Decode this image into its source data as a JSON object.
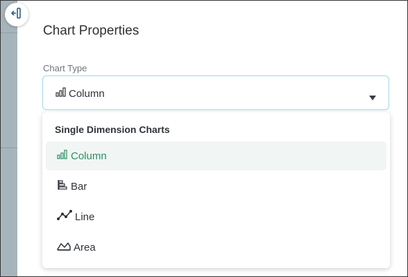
{
  "panel": {
    "title": "Chart Properties",
    "collapse_icon": "collapse-left-icon"
  },
  "chart_type": {
    "label": "Chart Type",
    "selected_value": "Column",
    "selected_icon": "column-chart-icon"
  },
  "dropdown": {
    "group_label": "Single Dimension Charts",
    "options": [
      {
        "label": "Column",
        "icon": "column-chart-icon",
        "selected": true
      },
      {
        "label": "Bar",
        "icon": "bar-chart-icon",
        "selected": false
      },
      {
        "label": "Line",
        "icon": "line-chart-icon",
        "selected": false
      },
      {
        "label": "Area",
        "icon": "area-chart-icon",
        "selected": false
      }
    ]
  },
  "colors": {
    "accent_green": "#2c8f63",
    "focus_border": "#9ed8e8",
    "selected_bg": "#f1f5f4",
    "sidebar_strip": "#a6b5bc"
  }
}
